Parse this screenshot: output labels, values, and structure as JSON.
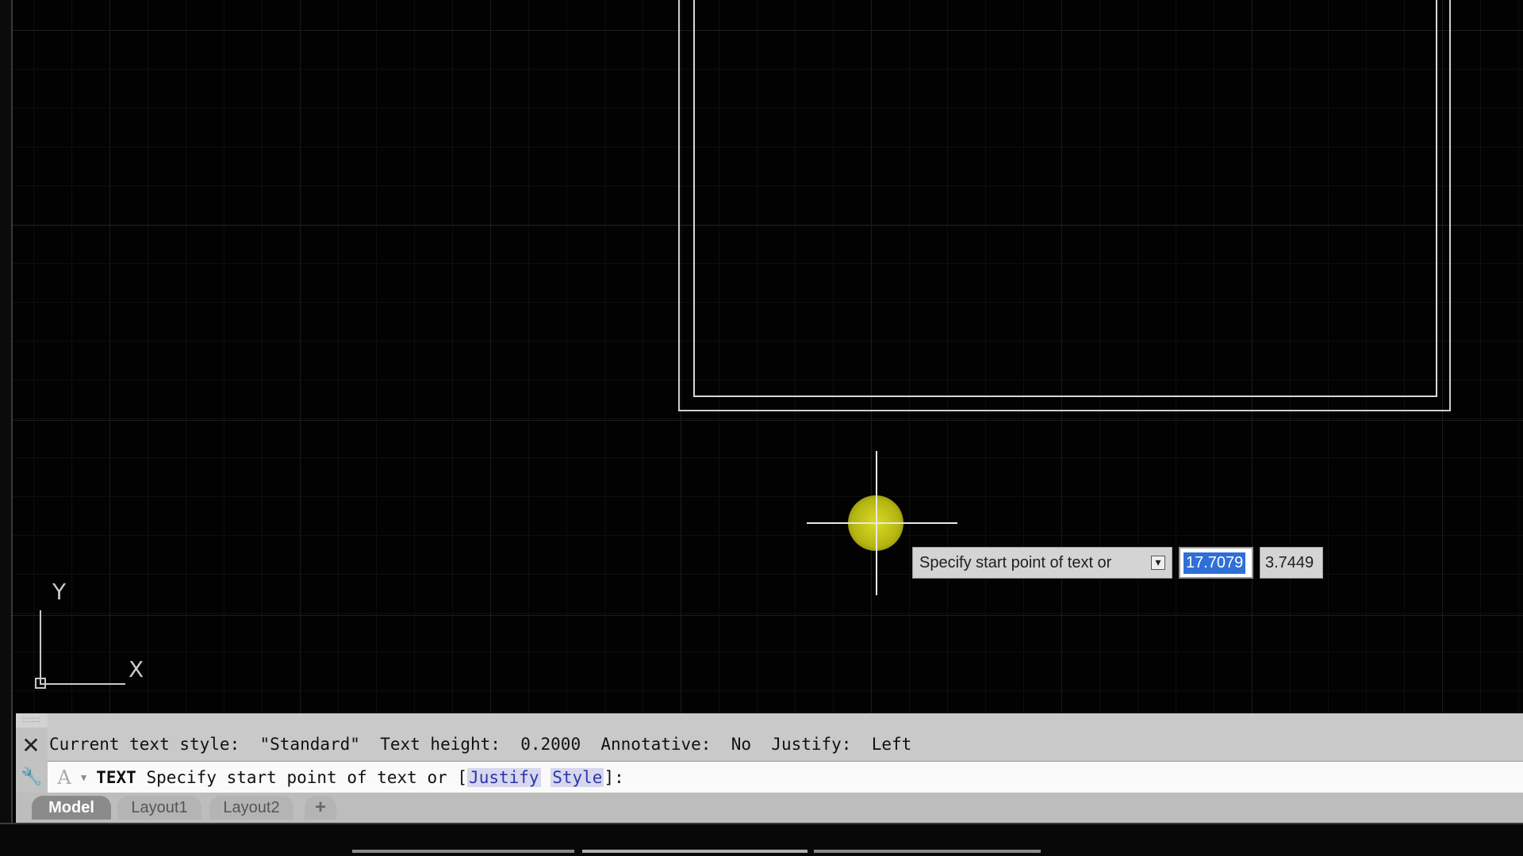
{
  "canvas": {
    "ucs": {
      "y_label": "Y",
      "x_label": "X"
    }
  },
  "dynamic_input": {
    "prompt": "Specify start point of text or",
    "options_icon": "down-arrow-icon",
    "x_value": "17.7079",
    "y_value": "3.7449"
  },
  "command_line": {
    "history_line": "Current text style:  \"Standard\"  Text height:  0.2000  Annotative:  No  Justify:  Left",
    "command_name": "TEXT",
    "prompt_prefix": " Specify start point of text or [",
    "option_justify": "Justify",
    "option_style": "Style",
    "prompt_suffix": "]:",
    "close_icon": "close-icon",
    "customize_icon": "wrench-icon",
    "grip": "::::::"
  },
  "tabs": {
    "model": "Model",
    "layout1": "Layout1",
    "layout2": "Layout2",
    "add": "+"
  },
  "colors": {
    "canvas_bg": "#020202",
    "cursor_highlight": "#d2d21e",
    "selection_blue": "#2f6fd6"
  }
}
